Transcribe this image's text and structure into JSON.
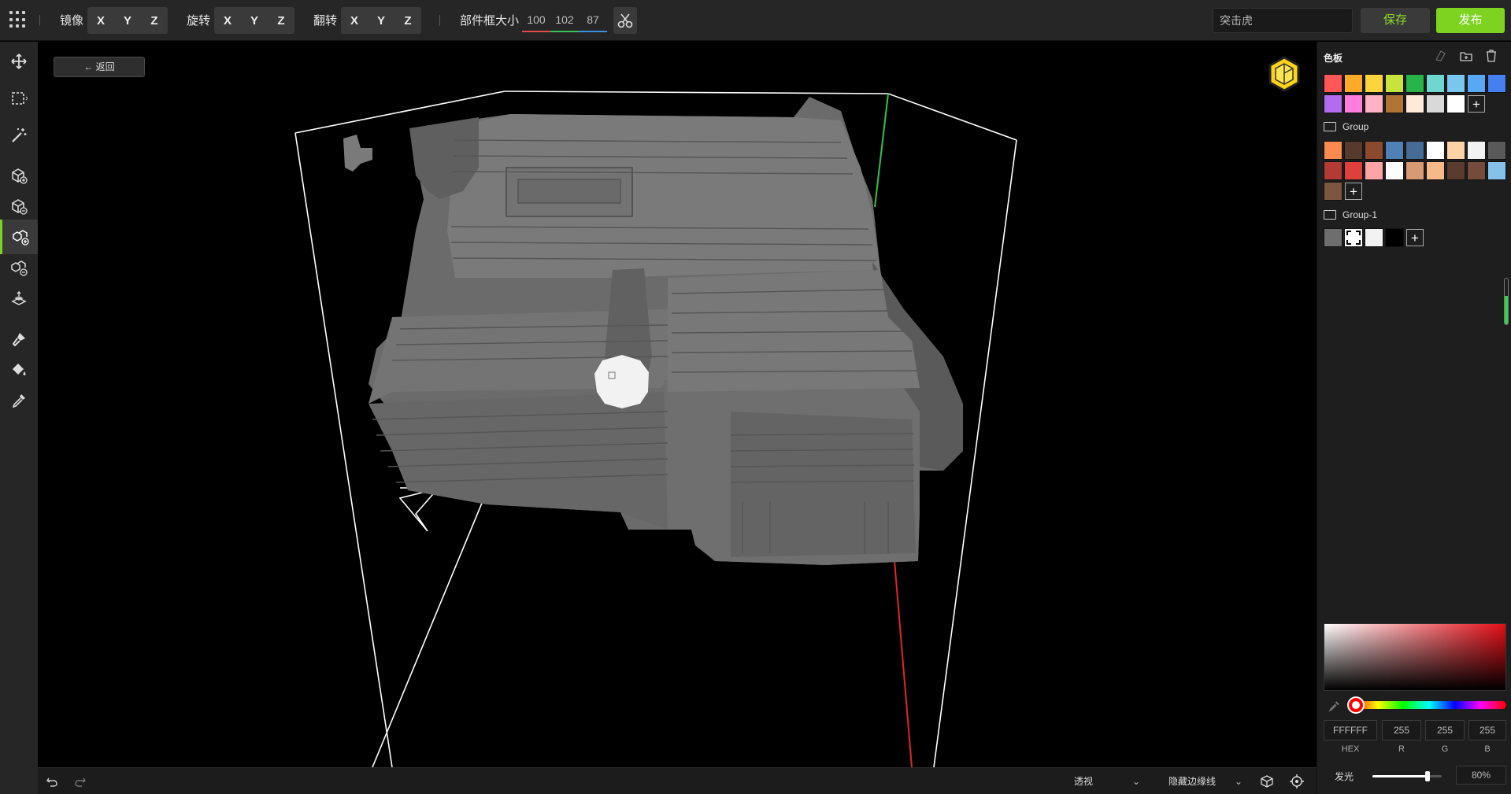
{
  "toolbar": {
    "mirror_label": "镜像",
    "rotate_label": "旋转",
    "flip_label": "翻转",
    "axes": [
      "X",
      "Y",
      "Z"
    ],
    "bbox_label": "部件框大小",
    "bbox_values": [
      "100",
      "102",
      "87"
    ],
    "name_value": "突击虎",
    "save_label": "保存",
    "publish_label": "发布"
  },
  "viewport": {
    "back_label": "← 返回"
  },
  "bottombar": {
    "view_mode": "透视",
    "edge_mode": "隐藏边缘线"
  },
  "palette": {
    "title": "色板",
    "main_colors": [
      "#ff5757",
      "#ffa928",
      "#ffd43c",
      "#c6e43c",
      "#27b54a",
      "#6ed7cf",
      "#79c7ef",
      "#59a8f5",
      "#4580f0",
      "#b46bf0",
      "#ff7ddd",
      "#ffb3c4",
      "#b07534",
      "#ffe9d8",
      "#d9d9d9",
      "#ffffff"
    ],
    "groups": [
      {
        "name": "Group",
        "colors": [
          "#fb8a50",
          "#573a2e",
          "#8b4a2d",
          "#5081b6",
          "#466c95",
          "#ffffff",
          "#ffd1a7",
          "#f2f2f2",
          "#595959",
          "#b43a35",
          "#e0403a",
          "#ffa4a6",
          "#ffffff",
          "#d79a72",
          "#f7b88a",
          "#5b3b2e",
          "#744b3c",
          "#85c1ea",
          "#7c5640"
        ]
      },
      {
        "name": "Group-1",
        "colors": [
          "#6e6e6e",
          "#ffffff",
          "#f2f2f2",
          "#000000"
        ]
      }
    ]
  },
  "color_picker": {
    "hex": "FFFFFF",
    "r": "255",
    "g": "255",
    "b": "255",
    "hex_label": "HEX",
    "r_label": "R",
    "g_label": "G",
    "b_label": "B",
    "glow_label": "发光",
    "glow_value": "80%",
    "glow_level": 0.8
  }
}
